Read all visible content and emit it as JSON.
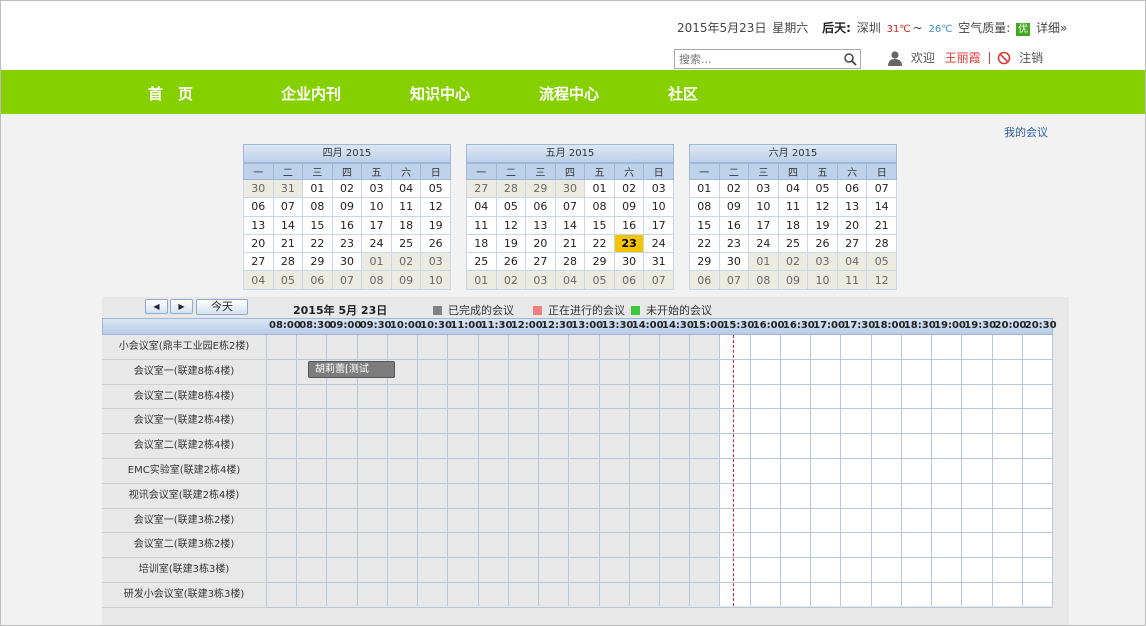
{
  "header": {
    "date": "2015年5月23日",
    "weekday": "星期六",
    "weather_label": "后天:",
    "city": "深圳",
    "temp_high": "31℃",
    "temp_sep": "~",
    "temp_low": "26℃",
    "air_label": "空气质量:",
    "air_quality": "优",
    "detail_link": "详细»",
    "search_placeholder": "搜索...",
    "welcome": "欢迎",
    "username": "王丽霞",
    "logout": "注销"
  },
  "nav": [
    "首　页",
    "企业内刊",
    "知识中心",
    "流程中心",
    "社区"
  ],
  "my_meetings_link": "我的会议",
  "weekdays": [
    "一",
    "二",
    "三",
    "四",
    "五",
    "六",
    "日"
  ],
  "calendars": [
    {
      "title": "四月 2015",
      "weeks": [
        [
          "30",
          "31",
          "01",
          "02",
          "03",
          "04",
          "05"
        ],
        [
          "06",
          "07",
          "08",
          "09",
          "10",
          "11",
          "12"
        ],
        [
          "13",
          "14",
          "15",
          "16",
          "17",
          "18",
          "19"
        ],
        [
          "20",
          "21",
          "22",
          "23",
          "24",
          "25",
          "26"
        ],
        [
          "27",
          "28",
          "29",
          "30",
          "01",
          "02",
          "03"
        ],
        [
          "04",
          "05",
          "06",
          "07",
          "08",
          "09",
          "10"
        ]
      ],
      "other_month": [
        [
          0,
          0
        ],
        [
          0,
          1
        ],
        [
          4,
          4
        ],
        [
          4,
          5
        ],
        [
          4,
          6
        ],
        [
          5,
          0
        ],
        [
          5,
          1
        ],
        [
          5,
          2
        ],
        [
          5,
          3
        ],
        [
          5,
          4
        ],
        [
          5,
          5
        ],
        [
          5,
          6
        ]
      ]
    },
    {
      "title": "五月 2015",
      "weeks": [
        [
          "27",
          "28",
          "29",
          "30",
          "01",
          "02",
          "03"
        ],
        [
          "04",
          "05",
          "06",
          "07",
          "08",
          "09",
          "10"
        ],
        [
          "11",
          "12",
          "13",
          "14",
          "15",
          "16",
          "17"
        ],
        [
          "18",
          "19",
          "20",
          "21",
          "22",
          "23",
          "24"
        ],
        [
          "25",
          "26",
          "27",
          "28",
          "29",
          "30",
          "31"
        ],
        [
          "01",
          "02",
          "03",
          "04",
          "05",
          "06",
          "07"
        ]
      ],
      "other_month": [
        [
          0,
          0
        ],
        [
          0,
          1
        ],
        [
          0,
          2
        ],
        [
          0,
          3
        ],
        [
          5,
          0
        ],
        [
          5,
          1
        ],
        [
          5,
          2
        ],
        [
          5,
          3
        ],
        [
          5,
          4
        ],
        [
          5,
          5
        ],
        [
          5,
          6
        ]
      ],
      "today": [
        3,
        5
      ]
    },
    {
      "title": "六月 2015",
      "weeks": [
        [
          "01",
          "02",
          "03",
          "04",
          "05",
          "06",
          "07"
        ],
        [
          "08",
          "09",
          "10",
          "11",
          "12",
          "13",
          "14"
        ],
        [
          "15",
          "16",
          "17",
          "18",
          "19",
          "20",
          "21"
        ],
        [
          "22",
          "23",
          "24",
          "25",
          "26",
          "27",
          "28"
        ],
        [
          "29",
          "30",
          "01",
          "02",
          "03",
          "04",
          "05"
        ],
        [
          "06",
          "07",
          "08",
          "09",
          "10",
          "11",
          "12"
        ]
      ],
      "other_month": [
        [
          4,
          2
        ],
        [
          4,
          3
        ],
        [
          4,
          4
        ],
        [
          4,
          5
        ],
        [
          4,
          6
        ],
        [
          5,
          0
        ],
        [
          5,
          1
        ],
        [
          5,
          2
        ],
        [
          5,
          3
        ],
        [
          5,
          4
        ],
        [
          5,
          5
        ],
        [
          5,
          6
        ]
      ]
    }
  ],
  "schedule": {
    "prev_icon": "◀",
    "next_icon": "▶",
    "today_button": "今天",
    "current_date": "2015年 5月 23日",
    "legend": [
      {
        "label": "已完成的会议",
        "color": "#808080"
      },
      {
        "label": "正在进行的会议",
        "color": "#f08080"
      },
      {
        "label": "未开始的会议",
        "color": "#3cc83c"
      }
    ],
    "times": [
      "08:00",
      "08:30",
      "09:00",
      "09:30",
      "10:00",
      "10:30",
      "11:00",
      "11:30",
      "12:00",
      "12:30",
      "13:00",
      "13:30",
      "14:00",
      "14:30",
      "15:00",
      "15:30",
      "16:00",
      "16:30",
      "17:00",
      "17:30",
      "18:00",
      "18:30",
      "19:00",
      "19:30",
      "20:00",
      "20:30"
    ],
    "rooms": [
      "小会议室(鼎丰工业园E栋2楼)",
      "会议室一(联建8栋4楼)",
      "会议室二(联建8栋4楼)",
      "会议室一(联建2栋4楼)",
      "会议室二(联建2栋4楼)",
      "EMC实验室(联建2栋4楼)",
      "视讯会议室(联建2栋4楼)",
      "会议室一(联建3栋2楼)",
      "会议室二(联建3栋2楼)",
      "培训室(联建3栋3楼)",
      "研发小会议室(联建3栋3楼)"
    ],
    "event": {
      "label": "胡莉蕾[测试",
      "room_index": 1,
      "start": "08:30",
      "end": "10:00",
      "status": "已完成的会议"
    }
  },
  "colors": {
    "nav_bg": "#87d000",
    "today_bg": "#f5c400",
    "now_line": "#e02020"
  }
}
